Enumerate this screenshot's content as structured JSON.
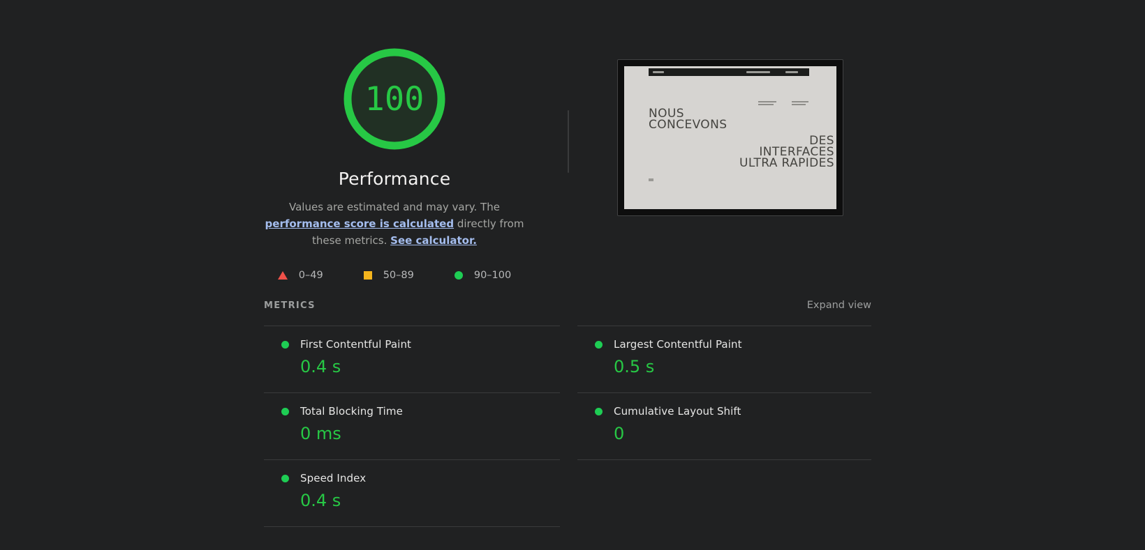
{
  "gauge": {
    "score": "100",
    "label": "Performance"
  },
  "description": {
    "pre": "Values are estimated and may vary. The ",
    "link1": "performance score is calculated",
    "mid": " directly from these metrics. ",
    "link2": "See calculator."
  },
  "legend": {
    "items": [
      {
        "range": "0–49",
        "shape": "triangle",
        "color": "#ef5149"
      },
      {
        "range": "50–89",
        "shape": "square",
        "color": "#f5b51d"
      },
      {
        "range": "90–100",
        "shape": "circle",
        "color": "#1ecd54"
      }
    ]
  },
  "metrics": {
    "section_label": "METRICS",
    "expand_label": "Expand view",
    "columns": [
      [
        {
          "name": "First Contentful Paint",
          "value": "0.4 s"
        },
        {
          "name": "Total Blocking Time",
          "value": "0 ms"
        },
        {
          "name": "Speed Index",
          "value": "0.4 s"
        }
      ],
      [
        {
          "name": "Largest Contentful Paint",
          "value": "0.5 s"
        },
        {
          "name": "Cumulative Layout Shift",
          "value": "0"
        }
      ]
    ]
  },
  "thumbnail": {
    "headline_left": [
      "NOUS",
      "CONCEVONS"
    ],
    "headline_right": [
      "DES",
      "INTERFACES",
      "ULTRA RAPIDES"
    ]
  },
  "colors": {
    "background": "#202122",
    "pass_green": "#27c845",
    "average_orange": "#f5b51d",
    "fail_red": "#ef5149",
    "link_blue": "#a4bdee"
  }
}
